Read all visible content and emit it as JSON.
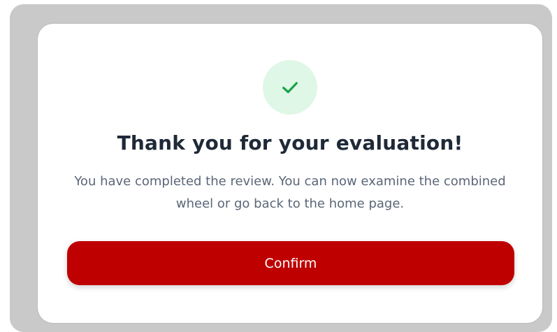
{
  "dialog": {
    "title": "Thank you for your evaluation!",
    "message": "You have completed the review. You can now examine the combined wheel or go back to the home page.",
    "confirm_label": "Confirm",
    "icon": "check-icon"
  },
  "colors": {
    "accent": "#BF0000",
    "success": "#16A34A",
    "success_bg": "#DFF7E6",
    "title": "#1F2937",
    "text": "#5B6678",
    "overlay": "#C9C9C9"
  }
}
